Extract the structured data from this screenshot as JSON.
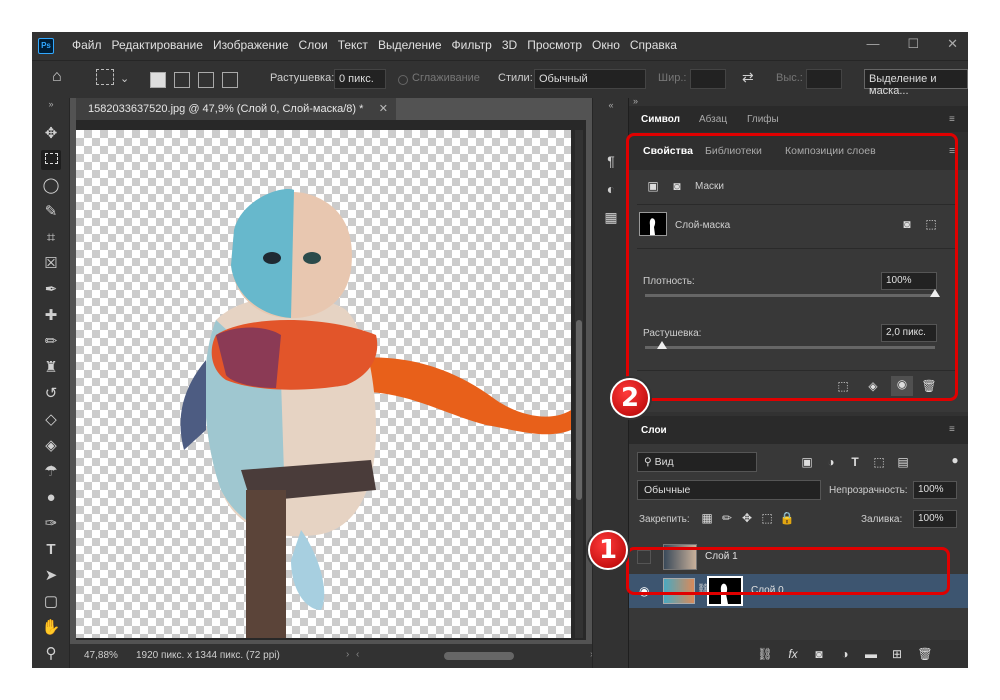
{
  "app": {
    "logo": "Ps"
  },
  "menu": [
    "Файл",
    "Редактирование",
    "Изображение",
    "Слои",
    "Текст",
    "Выделение",
    "Фильтр",
    "3D",
    "Просмотр",
    "Окно",
    "Справка"
  ],
  "window_controls": [
    "—",
    "☐",
    "✕"
  ],
  "options": {
    "feather_label": "Растушевка:",
    "feather_value": "0 пикс.",
    "antialias_label": "Сглаживание",
    "style_label": "Стили:",
    "style_value": "Обычный",
    "width_label": "Шир.:",
    "height_label": "Выс.:",
    "select_mask_button": "Выделение и маска..."
  },
  "document": {
    "tab_title": "1582033637520.jpg @ 47,9% (Слой 0, Слой-маска/8) *",
    "zoom": "47,88%",
    "info": "1920 пикс. x 1344 пикс. (72 ppi)"
  },
  "top_tabs": [
    "Символ",
    "Абзац",
    "Глифы"
  ],
  "properties": {
    "tabs": [
      "Свойства",
      "Библиотеки",
      "Композиции слоев"
    ],
    "section": "Маски",
    "mask_name": "Слой-маска",
    "density_label": "Плотность:",
    "density_value": "100%",
    "density_level": 1.0,
    "feather_label": "Растушевка:",
    "feather_value": "2,0 пикс.",
    "feather_level": 0.06
  },
  "layers": {
    "panel_title": "Слои",
    "filter_kind": "Вид",
    "blend_mode": "Обычные",
    "opacity_label": "Непрозрачность:",
    "opacity_value": "100%",
    "lock_label": "Закрепить:",
    "fill_label": "Заливка:",
    "fill_value": "100%",
    "items": [
      {
        "name": "Слой 1",
        "visible": false
      },
      {
        "name": "Слой 0",
        "visible": true
      }
    ]
  },
  "callouts": [
    "1",
    "2"
  ],
  "colors": {
    "highlight": "#e00000",
    "panel": "#383838",
    "selected_layer": "#3d5570"
  }
}
